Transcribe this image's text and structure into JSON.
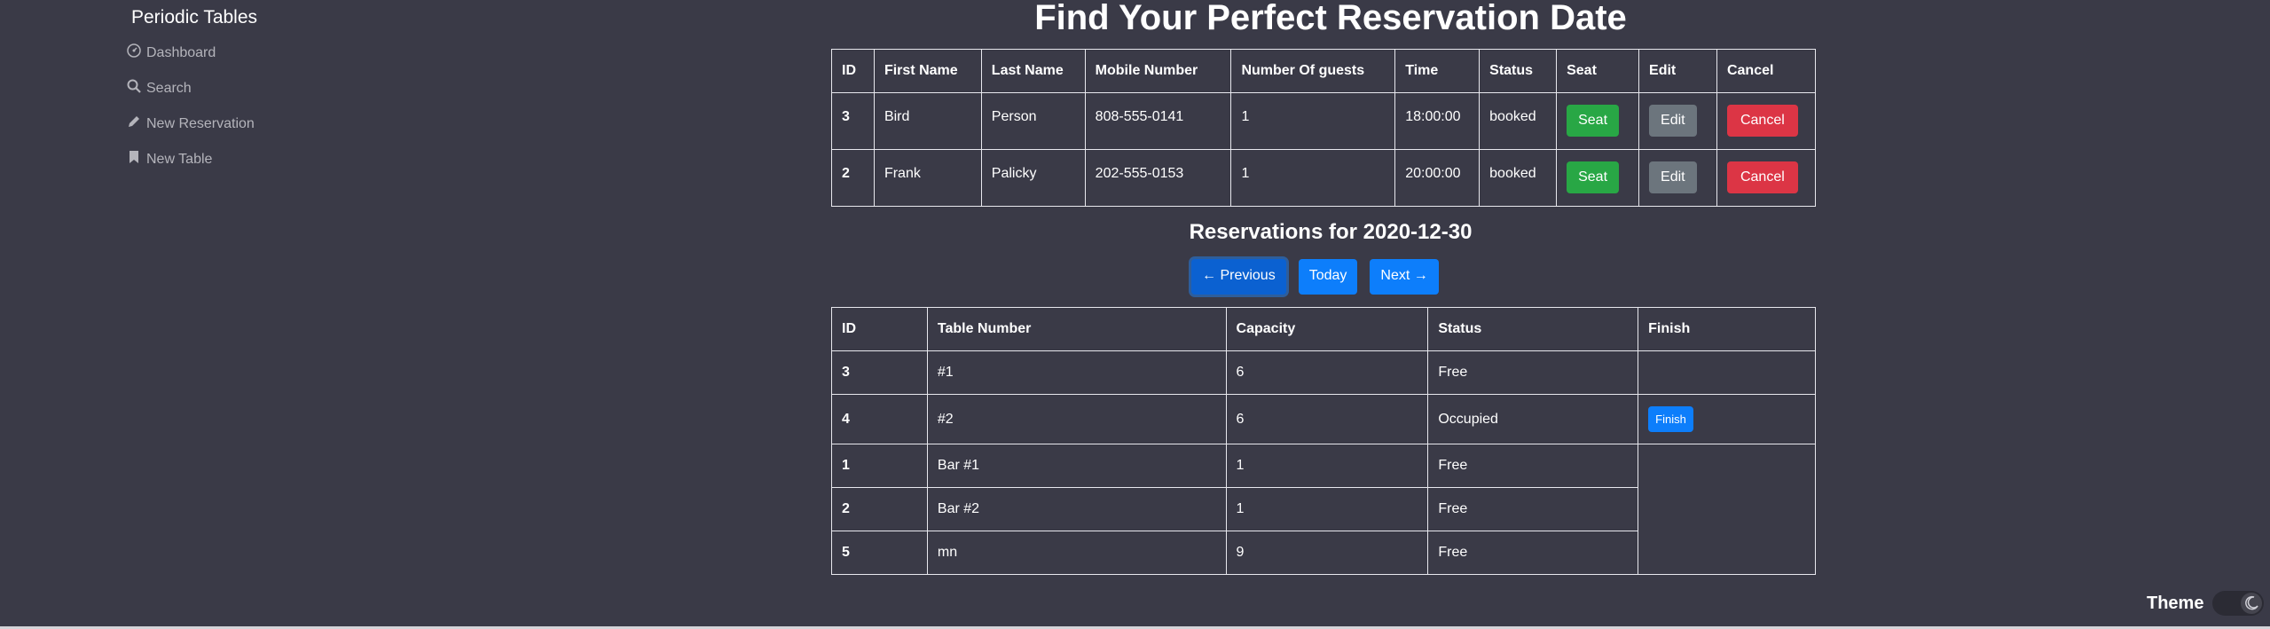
{
  "sidebar": {
    "brand": "Periodic Tables",
    "items": [
      {
        "label": "Dashboard",
        "icon": "dashboard-icon"
      },
      {
        "label": "Search",
        "icon": "search-icon"
      },
      {
        "label": "New Reservation",
        "icon": "pencil-icon"
      },
      {
        "label": "New Table",
        "icon": "bookmark-icon"
      }
    ]
  },
  "main": {
    "title": "Find Your Perfect Reservation Date",
    "reservations": {
      "headers": [
        "ID",
        "First Name",
        "Last Name",
        "Mobile Number",
        "Number Of guests",
        "Time",
        "Status",
        "Seat",
        "Edit",
        "Cancel"
      ],
      "rows": [
        {
          "id": "3",
          "first_name": "Bird",
          "last_name": "Person",
          "mobile": "808-555-0141",
          "guests": "1",
          "time": "18:00:00",
          "status": "booked",
          "seat": "Seat",
          "edit": "Edit",
          "cancel": "Cancel"
        },
        {
          "id": "2",
          "first_name": "Frank",
          "last_name": "Palicky",
          "mobile": "202-555-0153",
          "guests": "1",
          "time": "20:00:00",
          "status": "booked",
          "seat": "Seat",
          "edit": "Edit",
          "cancel": "Cancel"
        }
      ]
    },
    "subtitle": "Reservations for 2020-12-30",
    "date_nav": {
      "previous": "← Previous",
      "today": "Today",
      "next": "Next →"
    },
    "tables": {
      "headers": [
        "ID",
        "Table Number",
        "Capacity",
        "Status",
        "Finish"
      ],
      "rows": [
        {
          "id": "3",
          "table_number": "#1",
          "capacity": "6",
          "status": "Free",
          "finish": ""
        },
        {
          "id": "4",
          "table_number": "#2",
          "capacity": "6",
          "status": "Occupied",
          "finish": "Finish"
        },
        {
          "id": "1",
          "table_number": "Bar #1",
          "capacity": "1",
          "status": "Free",
          "finish": ""
        },
        {
          "id": "2",
          "table_number": "Bar #2",
          "capacity": "1",
          "status": "Free",
          "finish": ""
        },
        {
          "id": "5",
          "table_number": "mn",
          "capacity": "9",
          "status": "Free",
          "finish": ""
        }
      ]
    }
  },
  "theme": {
    "label": "Theme",
    "icon": "moon-icon"
  },
  "colors": {
    "background": "#3a3a47",
    "success": "#28a745",
    "secondary": "#6c757d",
    "danger": "#dc3545",
    "primary": "#0d7efb"
  }
}
